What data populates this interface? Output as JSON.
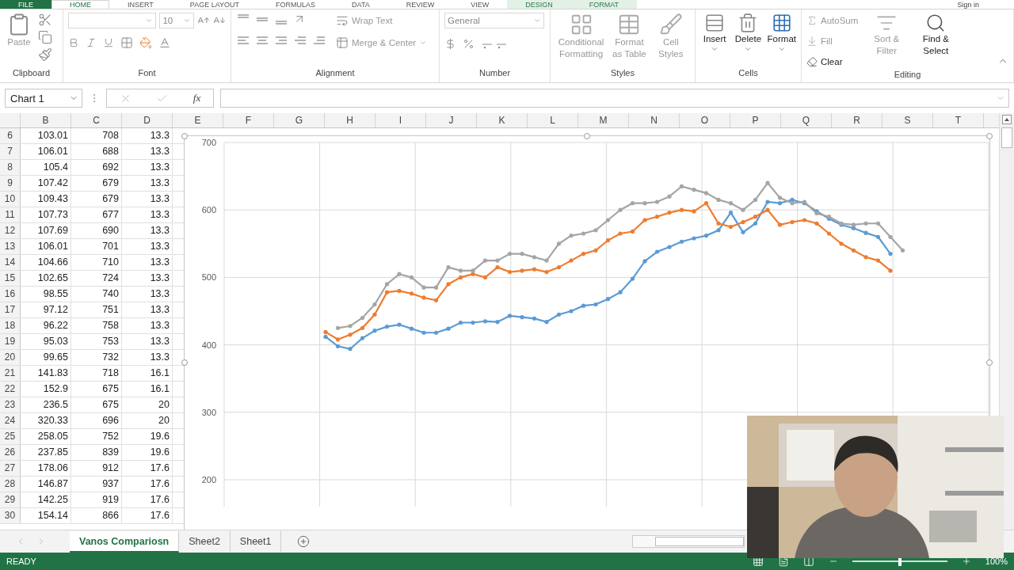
{
  "ribbon_tabs": [
    {
      "label": "FILE",
      "kind": "file",
      "selected": false
    },
    {
      "label": "HOME",
      "kind": "tab",
      "selected": true
    },
    {
      "label": "INSERT",
      "kind": "tab",
      "selected": false
    },
    {
      "label": "PAGE LAYOUT",
      "kind": "tab",
      "selected": false
    },
    {
      "label": "FORMULAS",
      "kind": "tab",
      "selected": false
    },
    {
      "label": "DATA",
      "kind": "tab",
      "selected": false
    },
    {
      "label": "REVIEW",
      "kind": "tab",
      "selected": false
    },
    {
      "label": "VIEW",
      "kind": "tab",
      "selected": false
    },
    {
      "label": "DESIGN",
      "kind": "context",
      "selected": false
    },
    {
      "label": "FORMAT",
      "kind": "context",
      "selected": false
    }
  ],
  "account": "Sign in",
  "clipboard": {
    "title": "Clipboard",
    "paste": "Paste"
  },
  "font": {
    "title": "Font",
    "font_size": "10"
  },
  "alignment": {
    "title": "Alignment",
    "wrap_text": "Wrap Text",
    "merge": "Merge & Center"
  },
  "number": {
    "title": "Number",
    "format": "General"
  },
  "styles": {
    "title": "Styles",
    "buttons": [
      {
        "label": "Conditional Formatting",
        "disabled": true
      },
      {
        "label": "Format as Table",
        "disabled": true
      },
      {
        "label": "Cell Styles",
        "disabled": true
      }
    ]
  },
  "cells": {
    "title": "Cells",
    "buttons": [
      {
        "label": "Insert",
        "disabled": false
      },
      {
        "label": "Delete",
        "disabled": false
      },
      {
        "label": "Format",
        "disabled": false
      }
    ]
  },
  "editing": {
    "title": "Editing",
    "small": [
      {
        "label": "AutoSum",
        "disabled": true
      },
      {
        "label": "Fill",
        "disabled": true
      },
      {
        "label": "Clear",
        "disabled": false
      }
    ],
    "big": [
      {
        "label": "Sort & Filter",
        "disabled": true
      },
      {
        "label": "Find & Select",
        "disabled": false
      }
    ]
  },
  "name_box": "Chart 1",
  "formula_label": "fx",
  "columns": [
    "B",
    "C",
    "D",
    "E",
    "F",
    "G",
    "H",
    "I",
    "J",
    "K",
    "L",
    "M",
    "N",
    "O",
    "P",
    "Q",
    "R",
    "S",
    "T"
  ],
  "rows": [
    {
      "number": "6",
      "cells": [
        "103.01",
        "708",
        "13.3"
      ]
    },
    {
      "number": "7",
      "cells": [
        "106.01",
        "688",
        "13.3"
      ]
    },
    {
      "number": "8",
      "cells": [
        "105.4",
        "692",
        "13.3"
      ]
    },
    {
      "number": "9",
      "cells": [
        "107.42",
        "679",
        "13.3"
      ]
    },
    {
      "number": "10",
      "cells": [
        "109.43",
        "679",
        "13.3"
      ]
    },
    {
      "number": "11",
      "cells": [
        "107.73",
        "677",
        "13.3"
      ]
    },
    {
      "number": "12",
      "cells": [
        "107.69",
        "690",
        "13.3"
      ]
    },
    {
      "number": "13",
      "cells": [
        "106.01",
        "701",
        "13.3"
      ]
    },
    {
      "number": "14",
      "cells": [
        "104.66",
        "710",
        "13.3"
      ]
    },
    {
      "number": "15",
      "cells": [
        "102.65",
        "724",
        "13.3"
      ]
    },
    {
      "number": "16",
      "cells": [
        "98.55",
        "740",
        "13.3"
      ]
    },
    {
      "number": "17",
      "cells": [
        "97.12",
        "751",
        "13.3"
      ]
    },
    {
      "number": "18",
      "cells": [
        "96.22",
        "758",
        "13.3"
      ]
    },
    {
      "number": "19",
      "cells": [
        "95.03",
        "753",
        "13.3"
      ]
    },
    {
      "number": "20",
      "cells": [
        "99.65",
        "732",
        "13.3"
      ]
    },
    {
      "number": "21",
      "cells": [
        "141.83",
        "718",
        "16.1"
      ]
    },
    {
      "number": "22",
      "cells": [
        "152.9",
        "675",
        "16.1"
      ]
    },
    {
      "number": "23",
      "cells": [
        "236.5",
        "675",
        "20"
      ]
    },
    {
      "number": "24",
      "cells": [
        "320.33",
        "696",
        "20"
      ]
    },
    {
      "number": "25",
      "cells": [
        "258.05",
        "752",
        "19.6"
      ]
    },
    {
      "number": "26",
      "cells": [
        "237.85",
        "839",
        "19.6"
      ]
    },
    {
      "number": "27",
      "cells": [
        "178.06",
        "912",
        "17.6"
      ]
    },
    {
      "number": "28",
      "cells": [
        "146.87",
        "937",
        "17.6"
      ]
    },
    {
      "number": "29",
      "cells": [
        "142.25",
        "919",
        "17.6"
      ]
    },
    {
      "number": "30",
      "cells": [
        "154.14",
        "866",
        "17.6"
      ]
    }
  ],
  "chart": {
    "chart_data": {
      "type": "line",
      "grid": true,
      "ylim": [
        160,
        700
      ],
      "yticks": [
        200,
        300,
        400,
        500,
        600,
        700
      ],
      "series": [
        {
          "color": "#5b9bd5",
          "values": [
            412,
            398,
            394,
            410,
            421,
            427,
            430,
            424,
            418,
            418,
            424,
            433,
            433,
            435,
            434,
            443,
            441,
            439,
            434,
            445,
            450,
            458,
            460,
            468,
            478,
            498,
            524,
            538,
            545,
            553,
            558,
            562,
            570,
            596,
            567,
            580,
            612,
            610,
            615,
            610,
            598,
            587,
            578,
            573,
            566,
            560,
            535,
            null
          ]
        },
        {
          "color": "#ed7d31",
          "values": [
            419,
            408,
            415,
            425,
            445,
            478,
            480,
            476,
            470,
            466,
            490,
            500,
            505,
            500,
            515,
            508,
            510,
            512,
            508,
            515,
            525,
            535,
            540,
            555,
            565,
            568,
            585,
            590,
            596,
            600,
            598,
            610,
            580,
            575,
            582,
            590,
            600,
            578,
            582,
            585,
            580,
            565,
            550,
            540,
            530,
            525,
            510,
            null
          ]
        },
        {
          "color": "#a5a5a5",
          "values": [
            null,
            425,
            428,
            440,
            460,
            490,
            505,
            500,
            485,
            485,
            515,
            510,
            510,
            525,
            525,
            535,
            535,
            530,
            525,
            550,
            562,
            565,
            570,
            585,
            600,
            610,
            610,
            612,
            620,
            635,
            630,
            625,
            615,
            610,
            600,
            615,
            640,
            618,
            610,
            612,
            595,
            590,
            580,
            578,
            580,
            580,
            560,
            540
          ]
        }
      ]
    }
  },
  "sheet_tabs": [
    {
      "label": "Vanos Compariosn",
      "selected": true
    },
    {
      "label": "Sheet2",
      "selected": false
    },
    {
      "label": "Sheet1",
      "selected": false
    }
  ],
  "status": "READY",
  "zoom_slider": {
    "level": 0.5
  },
  "zoom": "100%"
}
